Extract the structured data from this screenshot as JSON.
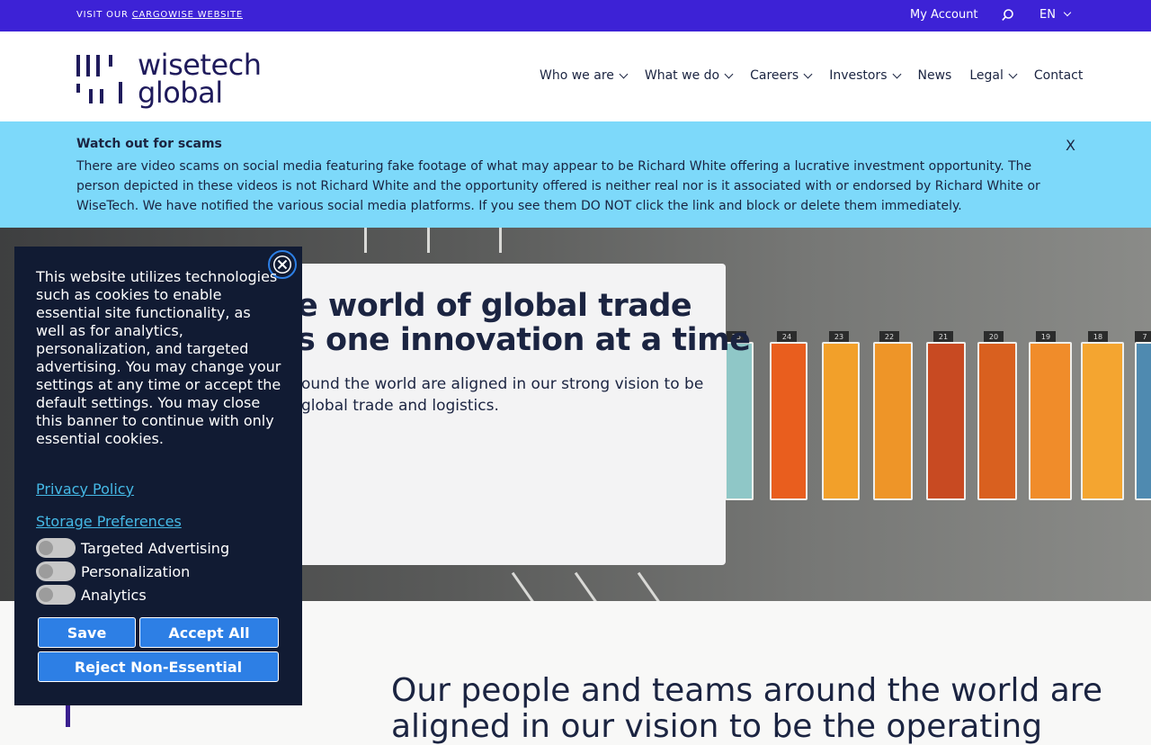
{
  "topbar": {
    "visit_prefix": "VISIT OUR",
    "cargowise_link": "CARGOWISE WEBSITE",
    "my_account": "My Account",
    "language": "EN"
  },
  "header": {
    "logo_line1": "wisetech",
    "logo_line2": "global",
    "nav": [
      {
        "label": "Who we are",
        "dropdown": true
      },
      {
        "label": "What we do",
        "dropdown": true
      },
      {
        "label": "Careers",
        "dropdown": true
      },
      {
        "label": "Investors",
        "dropdown": true
      },
      {
        "label": "News",
        "dropdown": false
      },
      {
        "label": "Legal",
        "dropdown": true
      },
      {
        "label": "Contact",
        "dropdown": false
      }
    ]
  },
  "alert": {
    "title": "Watch out for scams",
    "body": "There are video scams on social media featuring fake footage of what may appear to be Richard White offering a lucrative investment opportunity. The person depicted in these videos is not Richard White and the opportunity offered is neither real nor is it associated with or endorsed by Richard White or WiseTech. We have notified the various social media platforms. If you see them DO NOT click the link and block or delete them immediately.",
    "close": "X"
  },
  "hero": {
    "headline_line1": "e world of global trade",
    "headline_line2": "s one innovation at a time",
    "sub_line1": "ound the world are aligned in our strong vision to be",
    "sub_line2": "global trade and logistics.",
    "container_numbers": [
      "25",
      "24",
      "23",
      "22",
      "21",
      "20",
      "19",
      "18",
      "7"
    ]
  },
  "lower": {
    "statement_line1": "Our people and teams around the world are",
    "statement_line2": "aligned in our vision to be the operating"
  },
  "cookie": {
    "message": "This website utilizes technologies such as cookies to enable essential site functionality, as well as for analytics, personalization, and targeted advertising. You may change your settings at any time or accept the default settings. You may close this banner to continue with only essential cookies.",
    "privacy_policy": "Privacy Policy",
    "storage_preferences": "Storage Preferences",
    "toggles": [
      {
        "label": "Targeted Advertising",
        "enabled": false
      },
      {
        "label": "Personalization",
        "enabled": false
      },
      {
        "label": "Analytics",
        "enabled": false
      }
    ],
    "save": "Save",
    "accept_all": "Accept All",
    "reject": "Reject Non-Essential"
  },
  "colors": {
    "topbar": "#3d22d6",
    "alert": "#7dd9fa",
    "navy": "#1b2441",
    "cookie_bg": "#111b33",
    "button": "#2d7fe5"
  }
}
